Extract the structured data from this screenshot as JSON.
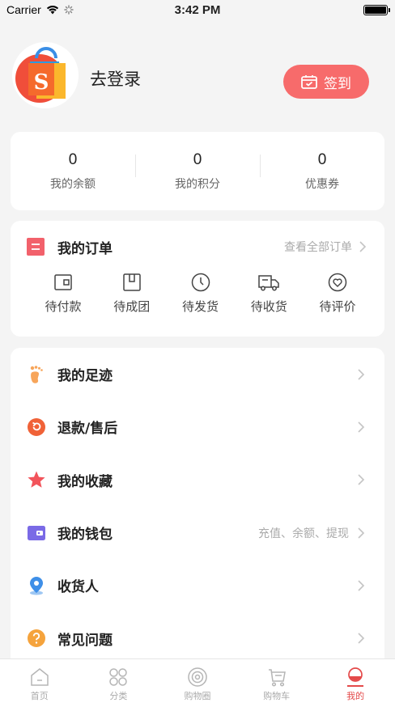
{
  "status_bar": {
    "carrier": "Carrier",
    "time": "3:42 PM"
  },
  "profile": {
    "login_text": "去登录",
    "checkin_label": "签到"
  },
  "stats": [
    {
      "value": "0",
      "label": "我的余额"
    },
    {
      "value": "0",
      "label": "我的积分"
    },
    {
      "value": "0",
      "label": "优惠券"
    }
  ],
  "orders": {
    "title": "我的订单",
    "view_all": "查看全部订单",
    "items": [
      {
        "label": "待付款",
        "icon": "wallet-icon"
      },
      {
        "label": "待成团",
        "icon": "box-icon"
      },
      {
        "label": "待发货",
        "icon": "clock-icon"
      },
      {
        "label": "待收货",
        "icon": "truck-icon"
      },
      {
        "label": "待评价",
        "icon": "heart-icon"
      }
    ]
  },
  "menu": [
    {
      "label": "我的足迹",
      "sub": "",
      "icon": "footprint-icon"
    },
    {
      "label": "退款/售后",
      "sub": "",
      "icon": "refund-icon"
    },
    {
      "label": "我的收藏",
      "sub": "",
      "icon": "star-icon"
    },
    {
      "label": "我的钱包",
      "sub": "充值、余额、提现",
      "icon": "purse-icon"
    },
    {
      "label": "收货人",
      "sub": "",
      "icon": "location-icon"
    },
    {
      "label": "常见问题",
      "sub": "",
      "icon": "question-icon"
    }
  ],
  "tabbar": [
    {
      "label": "首页",
      "icon": "home-icon"
    },
    {
      "label": "分类",
      "icon": "grid-icon"
    },
    {
      "label": "购物圈",
      "icon": "circle-icon"
    },
    {
      "label": "购物车",
      "icon": "cart-icon"
    },
    {
      "label": "我的",
      "icon": "profile-icon",
      "active": true
    }
  ],
  "colors": {
    "accent": "#f76b6b",
    "active_tab": "#e44a4a",
    "orders_icon": "#f2616b"
  }
}
